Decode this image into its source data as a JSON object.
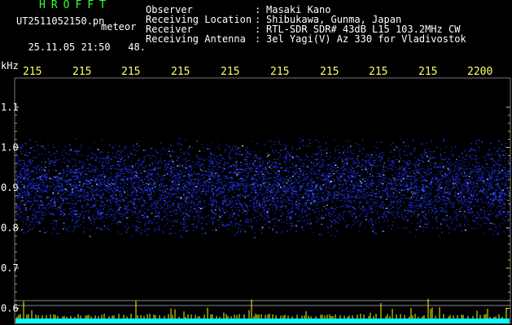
{
  "header": {
    "brand": "HROFFT",
    "filename": "UT2511052150.pn",
    "kind": "meteor",
    "datetime": "25.11.05 21:50",
    "count": "48."
  },
  "info": [
    {
      "label": "Observer",
      "value": "Masaki Kano"
    },
    {
      "label": "Receiving Location",
      "value": "Shibukawa, Gunma, Japan"
    },
    {
      "label": "Receiver",
      "value": "RTL-SDR SDR# 43dB L15 103.2MHz CW"
    },
    {
      "label": "Receiving Antenna",
      "value": "3el Yagi(V) Az 330 for Vladivostok"
    }
  ],
  "chart_data": {
    "type": "heatmap",
    "yunit": "kHz",
    "x_ticks": [
      "215",
      "215",
      "215",
      "215",
      "215",
      "215",
      "215",
      "215",
      "215",
      "2200"
    ],
    "y_ticks": [
      "1.1",
      "1.0",
      "0.9",
      "0.8",
      "0.7",
      "0.6"
    ],
    "ylim": [
      0.6,
      1.1
    ],
    "noise_band_khz": [
      0.78,
      1.02
    ],
    "colors": {
      "background": "#000000",
      "noise": "#2233ff",
      "baseline_fill": "#00ffff",
      "spikes": "#ffff00",
      "ticks": "#ffff66",
      "axis_text": "#ffffff"
    }
  }
}
